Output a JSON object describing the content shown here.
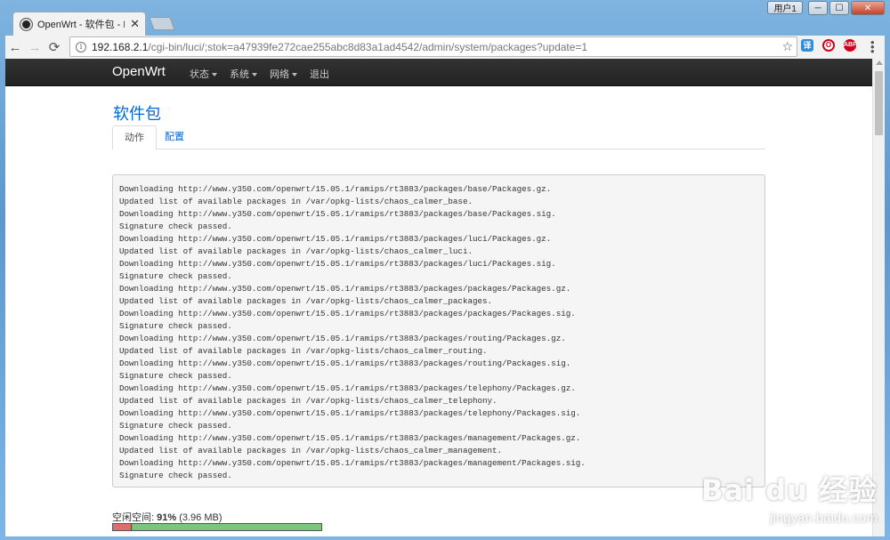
{
  "browser": {
    "tab_title": "OpenWrt - 软件包 - Lu",
    "tab_close": "✕",
    "url_host": "192.168.2.1",
    "url_path": "/cgi-bin/luci/;stok=a47939fe272cae255abc8d83a1ad4542/admin/system/packages?update=1",
    "user_button": "用户1",
    "window_min": "─",
    "window_max": "☐",
    "window_close": "✕",
    "ext1_label": "译",
    "ext2_label": "O",
    "ext3_label": "ABP"
  },
  "nav": {
    "brand": "OpenWrt",
    "items": [
      {
        "label": "状态"
      },
      {
        "label": "系统"
      },
      {
        "label": "网络"
      },
      {
        "label": "退出"
      }
    ]
  },
  "page": {
    "title": "软件包",
    "tabs": [
      {
        "label": "动作"
      },
      {
        "label": "配置"
      }
    ]
  },
  "log_lines": [
    "Downloading http://www.y350.com/openwrt/15.05.1/ramips/rt3883/packages/base/Packages.gz.",
    "Updated list of available packages in /var/opkg-lists/chaos_calmer_base.",
    "Downloading http://www.y350.com/openwrt/15.05.1/ramips/rt3883/packages/base/Packages.sig.",
    "Signature check passed.",
    "Downloading http://www.y350.com/openwrt/15.05.1/ramips/rt3883/packages/luci/Packages.gz.",
    "Updated list of available packages in /var/opkg-lists/chaos_calmer_luci.",
    "Downloading http://www.y350.com/openwrt/15.05.1/ramips/rt3883/packages/luci/Packages.sig.",
    "Signature check passed.",
    "Downloading http://www.y350.com/openwrt/15.05.1/ramips/rt3883/packages/packages/Packages.gz.",
    "Updated list of available packages in /var/opkg-lists/chaos_calmer_packages.",
    "Downloading http://www.y350.com/openwrt/15.05.1/ramips/rt3883/packages/packages/Packages.sig.",
    "Signature check passed.",
    "Downloading http://www.y350.com/openwrt/15.05.1/ramips/rt3883/packages/routing/Packages.gz.",
    "Updated list of available packages in /var/opkg-lists/chaos_calmer_routing.",
    "Downloading http://www.y350.com/openwrt/15.05.1/ramips/rt3883/packages/routing/Packages.sig.",
    "Signature check passed.",
    "Downloading http://www.y350.com/openwrt/15.05.1/ramips/rt3883/packages/telephony/Packages.gz.",
    "Updated list of available packages in /var/opkg-lists/chaos_calmer_telephony.",
    "Downloading http://www.y350.com/openwrt/15.05.1/ramips/rt3883/packages/telephony/Packages.sig.",
    "Signature check passed.",
    "Downloading http://www.y350.com/openwrt/15.05.1/ramips/rt3883/packages/management/Packages.gz.",
    "Updated list of available packages in /var/opkg-lists/chaos_calmer_management.",
    "Downloading http://www.y350.com/openwrt/15.05.1/ramips/rt3883/packages/management/Packages.sig.",
    "Signature check passed."
  ],
  "free_space": {
    "label": "空闲空间:",
    "percent_text": "91%",
    "size_text": "(3.96 MB)",
    "used_fraction": 0.09
  },
  "watermark": {
    "logo": "Bai du 经验",
    "url": "jingyan.baidu.com"
  },
  "colors": {
    "link": "#0069d6",
    "navbar": "#222222",
    "used_bar": "#e06c6c",
    "free_bar": "#7dc57d"
  }
}
